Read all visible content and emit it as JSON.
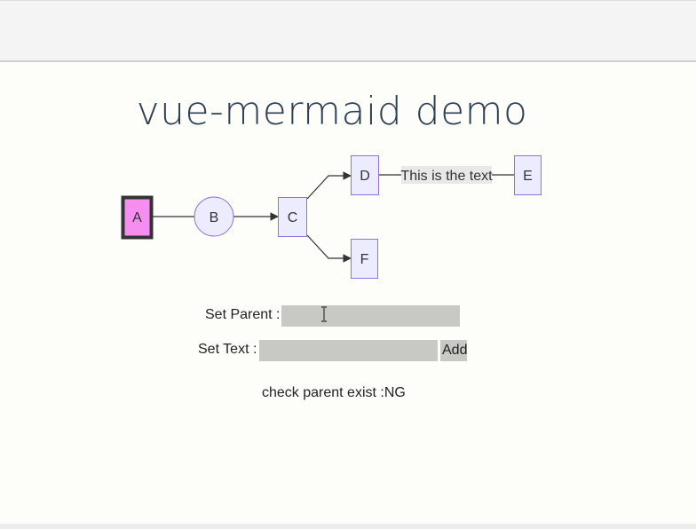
{
  "title": "vue-mermaid demo",
  "graph": {
    "nodes": {
      "A": "A",
      "B": "B",
      "C": "C",
      "D": "D",
      "E": "E",
      "F": "F"
    },
    "edge_label": "This is the text",
    "colors": {
      "node_fill": "#ececff",
      "node_stroke": "#9370db",
      "highlight_fill": "#f58ef0",
      "highlight_stroke": "#333333",
      "edge_stroke": "#333333",
      "edge_label_bg": "#e8e8e8"
    }
  },
  "form": {
    "parent_label": "Set Parent :",
    "parent_value": "",
    "text_label": "Set Text :",
    "text_value": "",
    "add_label": "Add"
  },
  "status": "check parent exist :NG"
}
